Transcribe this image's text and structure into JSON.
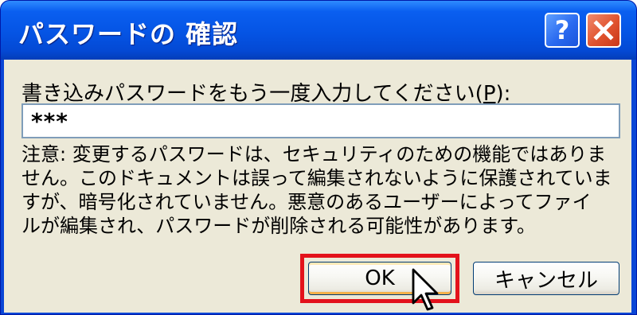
{
  "window": {
    "title": "パスワードの 確認",
    "help_button": "?",
    "close_button": "×"
  },
  "prompt": {
    "label": "書き込みパスワードをもう一度入力してください(",
    "accelerator": "P",
    "suffix": "):"
  },
  "password_field": {
    "value": "***"
  },
  "notice": {
    "lines": [
      "注意: 変更するパスワードは、セキュリティのための機能ではありま",
      "せん。このドキュメントは誤って編集されないように保護されていま",
      "すが、暗号化されていません。悪意のあるユーザーによってファイ",
      "ルが編集され、パスワードが削除される可能性があります。"
    ]
  },
  "buttons": {
    "ok": "OK",
    "cancel": "キャンセル"
  },
  "colors": {
    "titlebar": "#0554e4",
    "dialog_bg": "#ece9d8",
    "highlight": "#e3121b",
    "close_button": "#e0532e"
  },
  "icons": {
    "help": "question-mark-icon",
    "close": "close-x-icon",
    "cursor": "mouse-pointer-icon"
  }
}
